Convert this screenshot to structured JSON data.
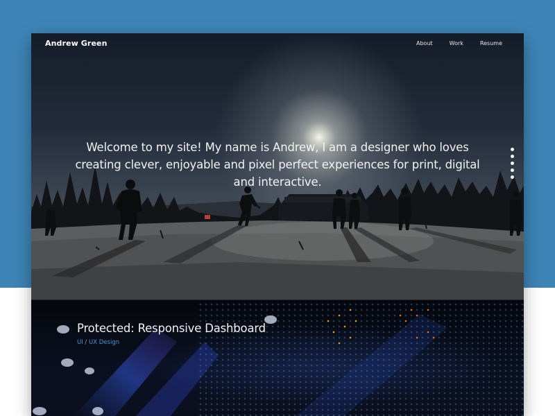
{
  "site": {
    "brand": "Andrew Green",
    "nav": [
      "About",
      "Work",
      "Resume"
    ]
  },
  "hero": {
    "intro": "Welcome to my site! My name is Andrew, I am a designer who loves creating clever, enjoyable and pixel perfect experiences for print, digital and interactive.",
    "dot_count": 5
  },
  "project": {
    "title": "Protected: Responsive Dashboard",
    "tag_1": "UI",
    "tag_sep": " / ",
    "tag_2": "UX Design"
  },
  "colors": {
    "backdrop_blue": "#3d84b6",
    "tag_link": "#3d9ad6",
    "text": "#f2f2f2"
  }
}
